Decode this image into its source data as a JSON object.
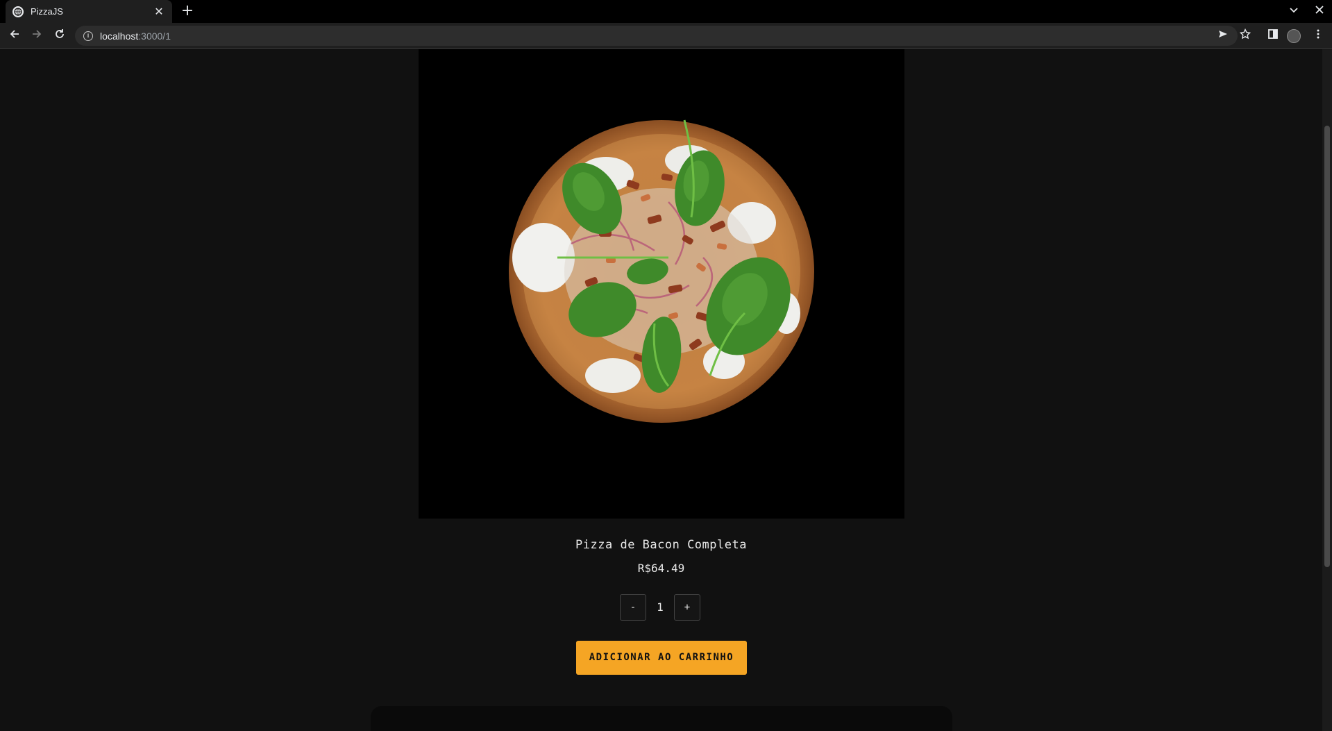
{
  "browser": {
    "tab_title": "PizzaJS",
    "tab_close": "✕",
    "new_tab": "+",
    "url_host": "localhost",
    "url_path": ":3000/1",
    "info_icon": "i"
  },
  "product": {
    "name": "Pizza de Bacon Completa",
    "price": "R$64.49",
    "quantity": "1",
    "decrement_label": "-",
    "increment_label": "+",
    "add_to_cart_label": "ADICIONAR AO CARRINHO"
  },
  "colors": {
    "accent": "#f5a524",
    "page_bg": "#111111",
    "image_bg": "#000000"
  }
}
